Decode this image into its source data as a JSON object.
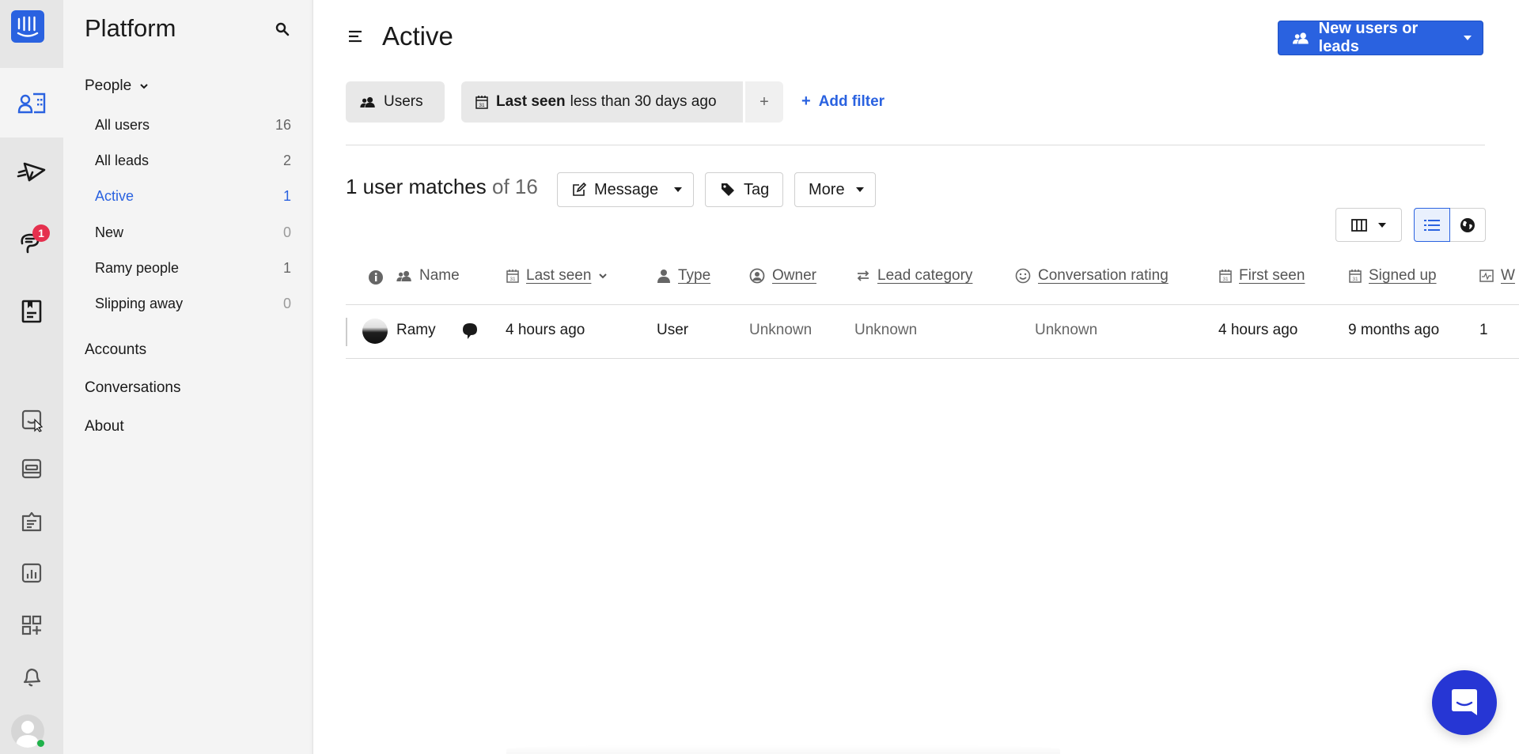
{
  "rail": {
    "logo": "intercom-logo-icon",
    "items": [
      {
        "name": "contacts-icon",
        "active": true
      },
      {
        "name": "outbound-send-icon",
        "active": false
      },
      {
        "name": "inbox-chat-icon",
        "active": false,
        "badge": "1"
      },
      {
        "name": "articles-icon",
        "active": false
      },
      {
        "name": "messenger-icon",
        "active": false
      },
      {
        "name": "operator-icon",
        "active": false
      },
      {
        "name": "tickets-icon",
        "active": false
      },
      {
        "name": "reports-icon",
        "active": false
      },
      {
        "name": "apps-add-icon",
        "active": false
      },
      {
        "name": "notifications-bell-icon",
        "active": false
      }
    ],
    "user_status": "online"
  },
  "sidebar": {
    "title": "Platform",
    "people_label": "People",
    "people_items": [
      {
        "label": "All users",
        "count": "16"
      },
      {
        "label": "All leads",
        "count": "2"
      },
      {
        "label": "Active",
        "count": "1",
        "active": true
      },
      {
        "label": "New",
        "count": "0"
      },
      {
        "label": "Ramy people",
        "count": "1"
      },
      {
        "label": "Slipping away",
        "count": "0"
      }
    ],
    "sections": [
      "Accounts",
      "Conversations",
      "About"
    ]
  },
  "header": {
    "title": "Active",
    "primary_button": "New users or leads"
  },
  "filters": {
    "audience": "Users",
    "filter_attr": "Last seen",
    "filter_value": "less than 30 days ago",
    "plus": "+",
    "add_filter": "Add filter"
  },
  "results": {
    "count_text": "1 user matches",
    "total_text": "of 16",
    "actions": {
      "message": "Message",
      "tag": "Tag",
      "more": "More"
    }
  },
  "table": {
    "columns": [
      {
        "label": "Name",
        "icon": "users-icon"
      },
      {
        "label": "Last seen",
        "icon": "calendar-icon",
        "sorted": true
      },
      {
        "label": "Type",
        "icon": "person-icon"
      },
      {
        "label": "Owner",
        "icon": "owner-icon"
      },
      {
        "label": "Lead category",
        "icon": "swap-arrows-icon"
      },
      {
        "label": "Conversation rating",
        "icon": "smiley-icon"
      },
      {
        "label": "First seen",
        "icon": "calendar-icon"
      },
      {
        "label": "Signed up",
        "icon": "calendar-icon"
      },
      {
        "label": "W",
        "icon": "activity-icon"
      }
    ],
    "rows": [
      {
        "name": "Ramy",
        "last_seen": "4 hours ago",
        "type": "User",
        "owner": "Unknown",
        "lead_category": "Unknown",
        "conversation_rating": "Unknown",
        "first_seen": "4 hours ago",
        "signed_up": "9 months ago",
        "w": "1"
      }
    ]
  },
  "colors": {
    "accent": "#2a62e0",
    "badge": "#e5304e",
    "launcher": "#2636d4",
    "online": "#1fb24a"
  }
}
